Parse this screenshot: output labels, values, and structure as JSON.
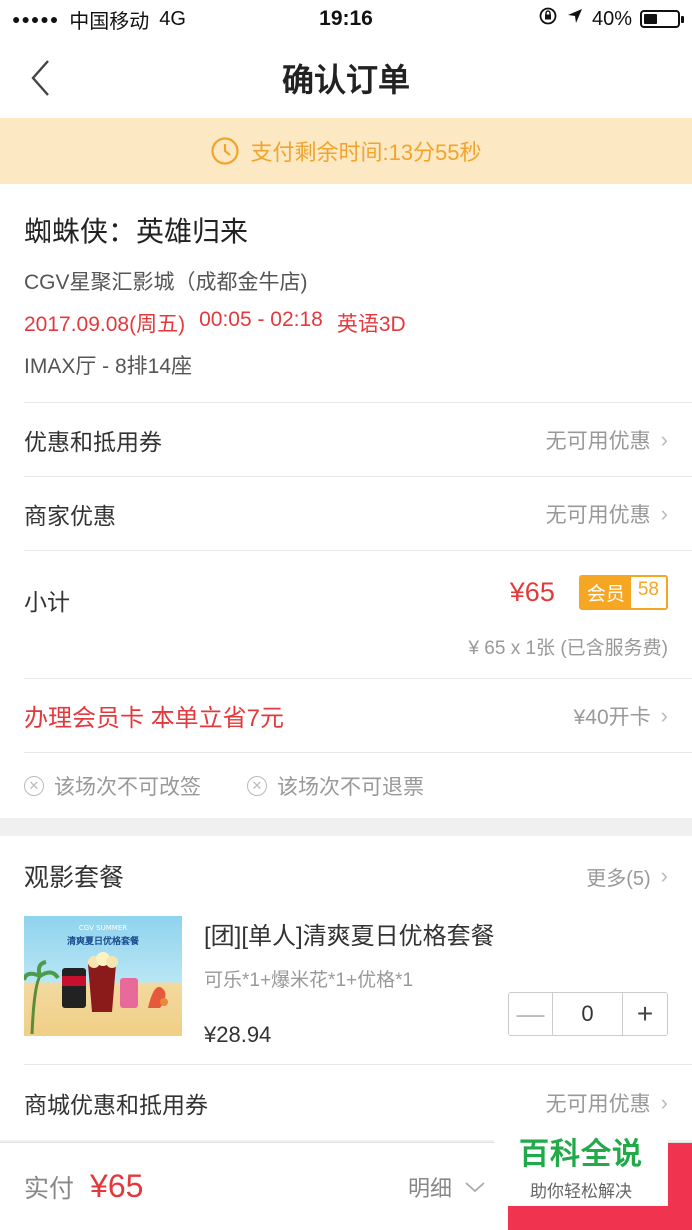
{
  "status_bar": {
    "signal": "●●●●●",
    "carrier": "中国移动",
    "network": "4G",
    "time": "19:16",
    "battery_text": "40%",
    "battery_level": 0.4
  },
  "nav": {
    "title": "确认订单"
  },
  "timer": {
    "text": "支付剩余时间:13分55秒"
  },
  "movie": {
    "title": "蜘蛛侠：英雄归来",
    "cinema": "CGV星聚汇影城（成都金牛店)",
    "date": "2017.09.08(周五)",
    "time": "00:05 - 02:18",
    "version": "英语3D",
    "hall": "IMAX厅 - 8排14座"
  },
  "coupon": {
    "label": "优惠和抵用券",
    "value": "无可用优惠"
  },
  "merchant": {
    "label": "商家优惠",
    "value": "无可用优惠"
  },
  "subtotal": {
    "label": "小计",
    "price": "¥65",
    "member_label": "会员",
    "member_price": "58",
    "note": "¥ 65 x 1张 (已含服务费)"
  },
  "member_card": {
    "label": "办理会员卡 本单立省7元",
    "value": "¥40开卡"
  },
  "policies": [
    "该场次不可改签",
    "该场次不可退票"
  ],
  "combo": {
    "title": "观影套餐",
    "more": "更多(5)",
    "item": {
      "name": "[团][单人]清爽夏日优格套餐",
      "desc": "可乐*1+爆米花*1+优格*1",
      "price": "¥28.94",
      "quantity": "0",
      "image_text": "清爽夏日优格套餐",
      "image_subtext": "CGV SUMMER"
    }
  },
  "mall_coupon": {
    "label": "商城优惠和抵用券",
    "value": "无可用优惠"
  },
  "bottom": {
    "pay_label": "实付",
    "pay_amount": "¥65",
    "detail": "明细"
  },
  "watermark": {
    "main": "百科全说",
    "sub": "助你轻松解决"
  },
  "colors": {
    "accent_red": "#e4393c",
    "timer_bg": "#fce9c4",
    "timer_text": "#f0a42c",
    "member_orange": "#f5a623",
    "pay_button": "#f0344f"
  }
}
